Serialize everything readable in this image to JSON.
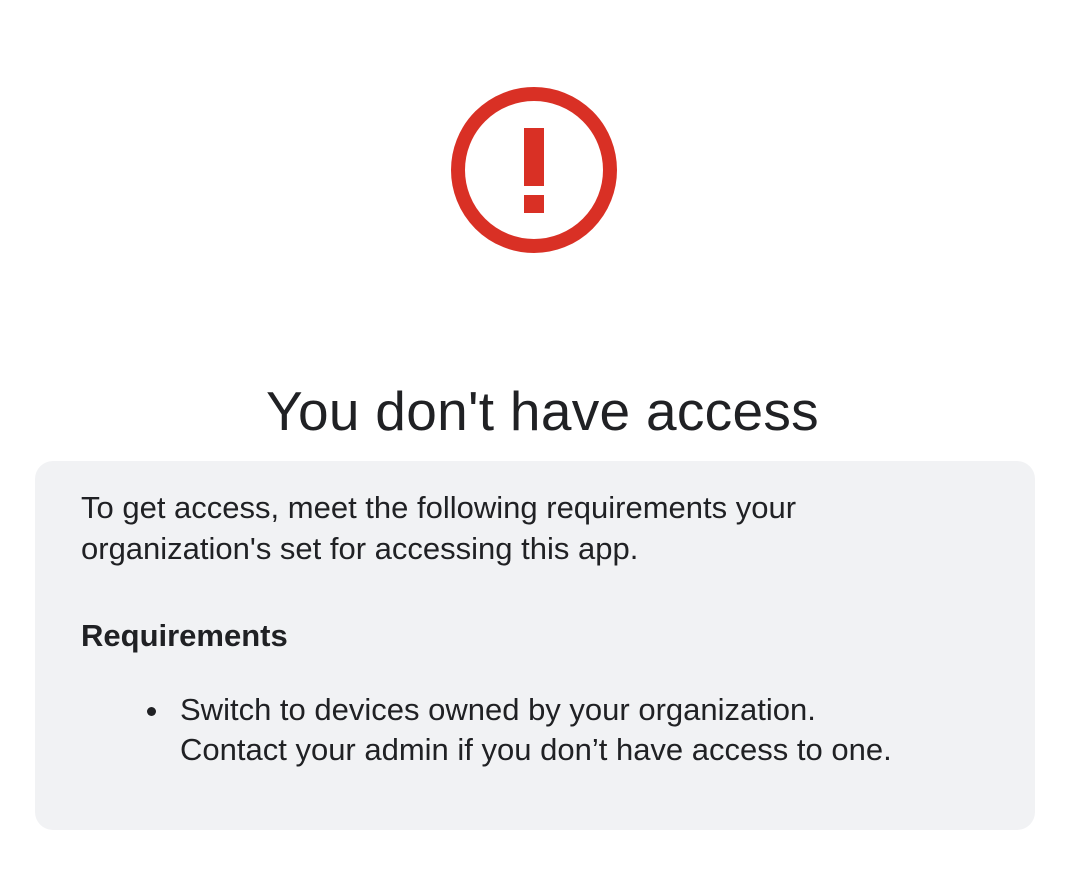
{
  "alert": {
    "icon": "exclamation-circle-icon",
    "color": "#d93025"
  },
  "title": "You don't have access",
  "panel": {
    "background": "#f1f2f4",
    "intro_line1": "To get access, meet the following requirements your",
    "intro_line2": "organization's set for accessing this app.",
    "requirements_heading": "Requirements",
    "requirements": [
      {
        "line1": "Switch to devices owned by your organization.",
        "line2": "Contact your admin if you don’t have access to one."
      }
    ]
  }
}
